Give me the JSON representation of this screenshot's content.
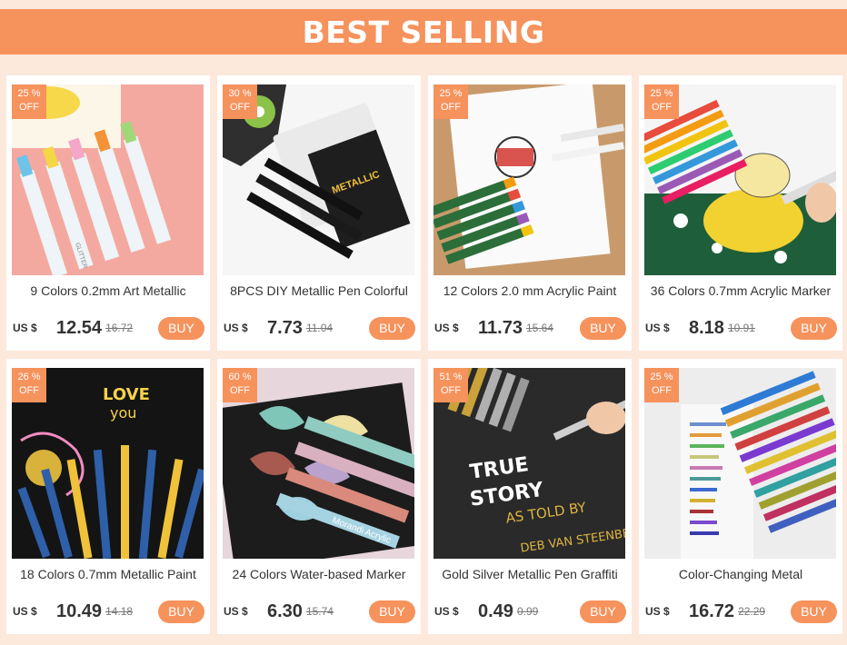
{
  "banner": {
    "title": "BEST SELLING"
  },
  "products": [
    {
      "discount_pct": "25 %",
      "discount_off": "OFF",
      "name": "9 Colors 0.2mm Art Metallic",
      "currency": "US $",
      "price": "12.54",
      "old_price": "16.72",
      "buy": "BUY"
    },
    {
      "discount_pct": "30 %",
      "discount_off": "OFF",
      "name": "8PCS DIY Metallic Pen Colorful",
      "currency": "US $",
      "price": "7.73",
      "old_price": "11.04",
      "buy": "BUY"
    },
    {
      "discount_pct": "25 %",
      "discount_off": "OFF",
      "name": "12 Colors 2.0 mm Acrylic Paint",
      "currency": "US $",
      "price": "11.73",
      "old_price": "15.64",
      "buy": "BUY"
    },
    {
      "discount_pct": "25 %",
      "discount_off": "OFF",
      "name": "36 Colors 0.7mm Acrylic Marker",
      "currency": "US $",
      "price": "8.18",
      "old_price": "10.91",
      "buy": "BUY"
    },
    {
      "discount_pct": "26 %",
      "discount_off": "OFF",
      "name": "18 Colors 0.7mm Metallic Paint",
      "currency": "US $",
      "price": "10.49",
      "old_price": "14.18",
      "buy": "BUY"
    },
    {
      "discount_pct": "60 %",
      "discount_off": "OFF",
      "name": "24 Colors Water-based Marker",
      "currency": "US $",
      "price": "6.30",
      "old_price": "15.74",
      "buy": "BUY"
    },
    {
      "discount_pct": "51 %",
      "discount_off": "OFF",
      "name": "Gold Silver Metallic Pen Graffiti",
      "currency": "US $",
      "price": "0.49",
      "old_price": "0.99",
      "buy": "BUY"
    },
    {
      "discount_pct": "25 %",
      "discount_off": "OFF",
      "name": "Color-Changing Metal",
      "currency": "US $",
      "price": "16.72",
      "old_price": "22.29",
      "buy": "BUY"
    }
  ],
  "image_text": {
    "p1_label": "GLITTER",
    "p2_box": "METALLIC",
    "p5_love": "LOVE",
    "p5_you": "you",
    "p6_label": "Morandi Acrylic",
    "p7_line1": "TRUE",
    "p7_line2": "STORY",
    "p7_line3": "AS TOLD BY",
    "p7_line4": "DEB VAN STEENBE"
  }
}
